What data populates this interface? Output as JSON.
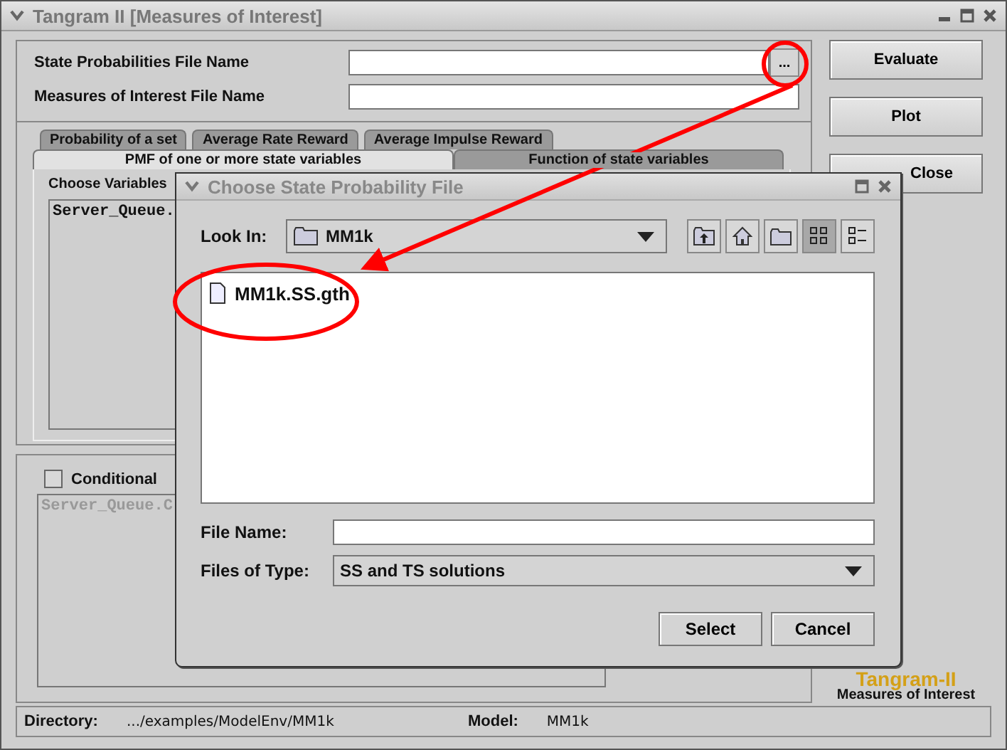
{
  "window": {
    "title": "Tangram II [Measures of Interest]"
  },
  "fields": [
    {
      "label": "State Probabilities File Name",
      "browse_button": "..."
    },
    {
      "label": "Measures of Interest File Name"
    }
  ],
  "tabs_row1": [
    {
      "label": "Probability of a set",
      "selected": false
    },
    {
      "label": "Average Rate Reward",
      "selected": false
    },
    {
      "label": "Average Impulse Reward",
      "selected": false
    }
  ],
  "tabs_row2": [
    {
      "label": "PMF of one or more state variables",
      "selected": true
    },
    {
      "label": "Function of state variables",
      "selected": false
    }
  ],
  "variables": {
    "label": "Choose Variables",
    "items": [
      "Server_Queue."
    ]
  },
  "conditional": {
    "label": "Conditional",
    "checked": false,
    "disabled": true,
    "items": [
      "Server_Queue.C"
    ]
  },
  "buttons": [
    "Evaluate",
    "Plot",
    "Close"
  ],
  "logo": {
    "name": "Tangram-II",
    "subtitle": "Measures of Interest"
  },
  "status_bar": {
    "directory_label": "Directory:",
    "directory": ".../examples/ModelEnv/MM1k",
    "model_label": "Model:",
    "model": "MM1k"
  },
  "dialog": {
    "title": "Choose State Probability File",
    "look_in_label": "Look In:",
    "look_in": "MM1k",
    "toolbar": [
      {
        "kind": "up",
        "selected": false
      },
      {
        "kind": "home",
        "selected": false
      },
      {
        "kind": "new-folder",
        "selected": false
      },
      {
        "kind": "list",
        "selected": true
      },
      {
        "kind": "details",
        "selected": false
      }
    ],
    "files": [
      "MM1k.SS.gth"
    ],
    "file_name_label": "File Name:",
    "files_of_type_label": "Files of Type:",
    "files_of_type": "SS and TS solutions",
    "buttons": [
      "Select",
      "Cancel"
    ]
  }
}
